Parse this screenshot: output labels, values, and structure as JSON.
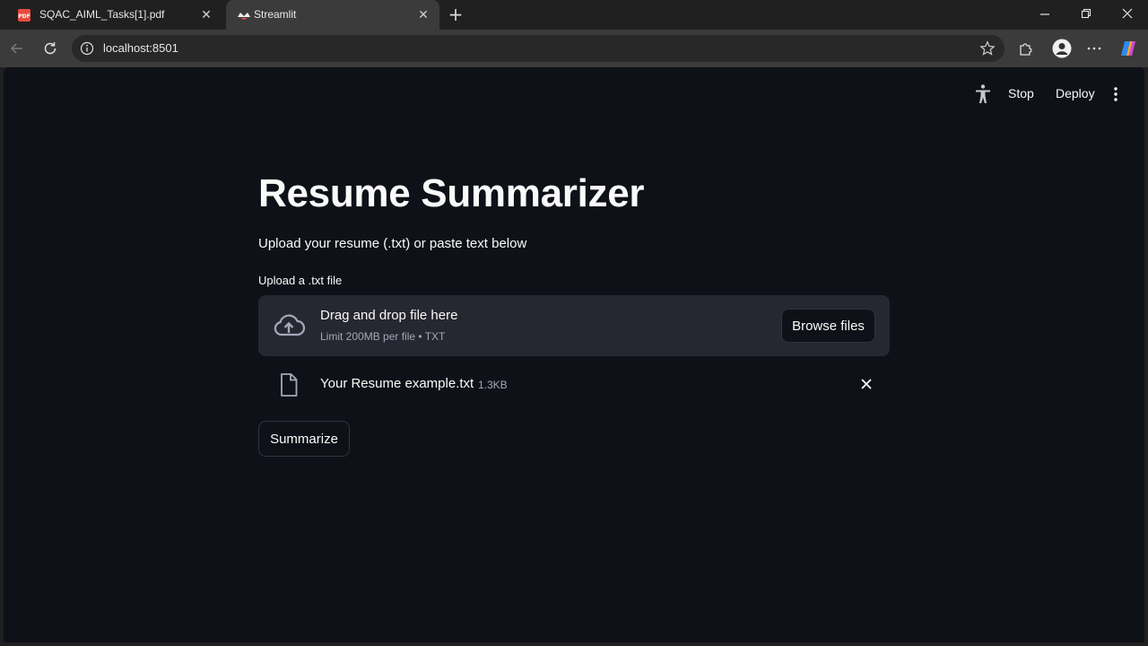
{
  "browser": {
    "tabs": [
      {
        "title": "SQAC_AIML_Tasks[1].pdf",
        "favicon": "pdf-icon",
        "active": false
      },
      {
        "title": "Streamlit",
        "favicon": "streamlit-icon",
        "active": true
      }
    ],
    "new_tab": "+",
    "address": {
      "url": "localhost:8501"
    }
  },
  "app_header": {
    "stop_label": "Stop",
    "deploy_label": "Deploy"
  },
  "main": {
    "title": "Resume Summarizer",
    "subtitle": "Upload your resume (.txt) or paste text below",
    "uploader": {
      "label": "Upload a .txt file",
      "drop_text": "Drag and drop file here",
      "limit_text": "Limit 200MB per file • TXT",
      "browse_label": "Browse files"
    },
    "uploaded_file": {
      "name": "Your Resume example.txt",
      "size": "1.3KB"
    },
    "summarize_label": "Summarize"
  },
  "colors": {
    "page_bg": "#0e1117",
    "dropzone_bg": "#262730",
    "text": "#fafafa",
    "muted_text": "#a3a8b8",
    "chrome_bg": "#202020",
    "toolbar_bg": "#3b3b3b"
  }
}
